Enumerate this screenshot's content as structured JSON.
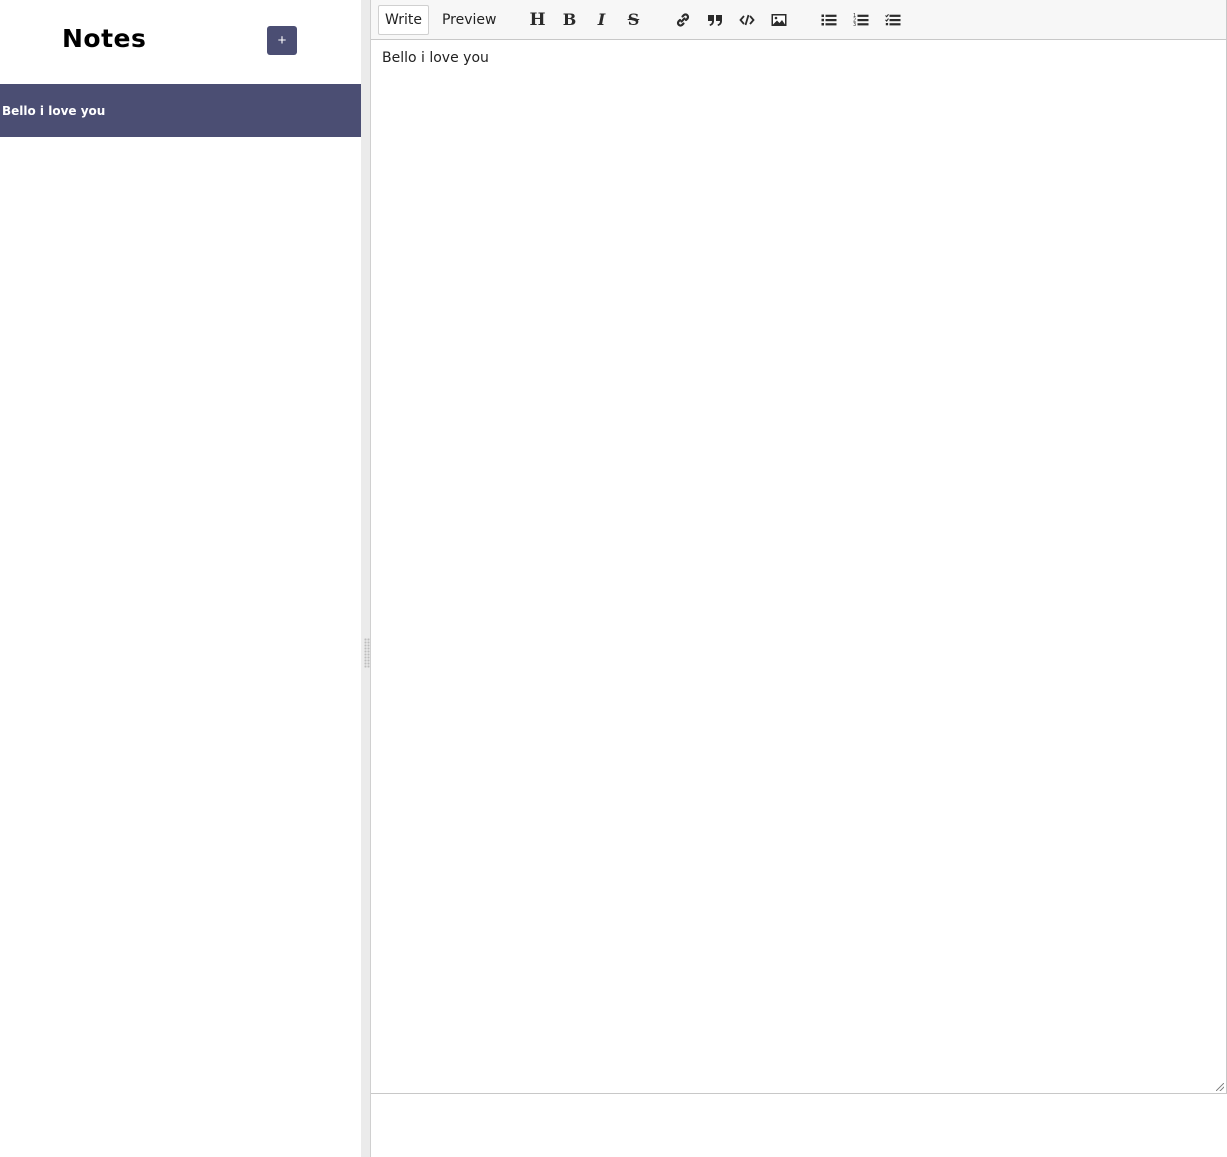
{
  "sidebar": {
    "title": "Notes",
    "add_label": "+",
    "notes": [
      {
        "title": "Bello i love you"
      }
    ]
  },
  "editor": {
    "tabs": [
      {
        "label": "Write",
        "active": true
      },
      {
        "label": "Preview",
        "active": false
      }
    ],
    "toolbar": {
      "header_glyph": "H",
      "bold_glyph": "B",
      "italic_glyph": "I",
      "strike_glyph": "S",
      "icons": [
        "header-icon",
        "bold-icon",
        "italic-icon",
        "strikethrough-icon",
        "link-icon",
        "quote-icon",
        "code-icon",
        "image-icon",
        "unordered-list-icon",
        "ordered-list-icon",
        "checklist-icon"
      ]
    },
    "content": "Bello i love you"
  },
  "colors": {
    "accent": "#4b4e73",
    "toolbar_bg": "#f7f7f7",
    "splitter_bg": "#ebebeb"
  }
}
